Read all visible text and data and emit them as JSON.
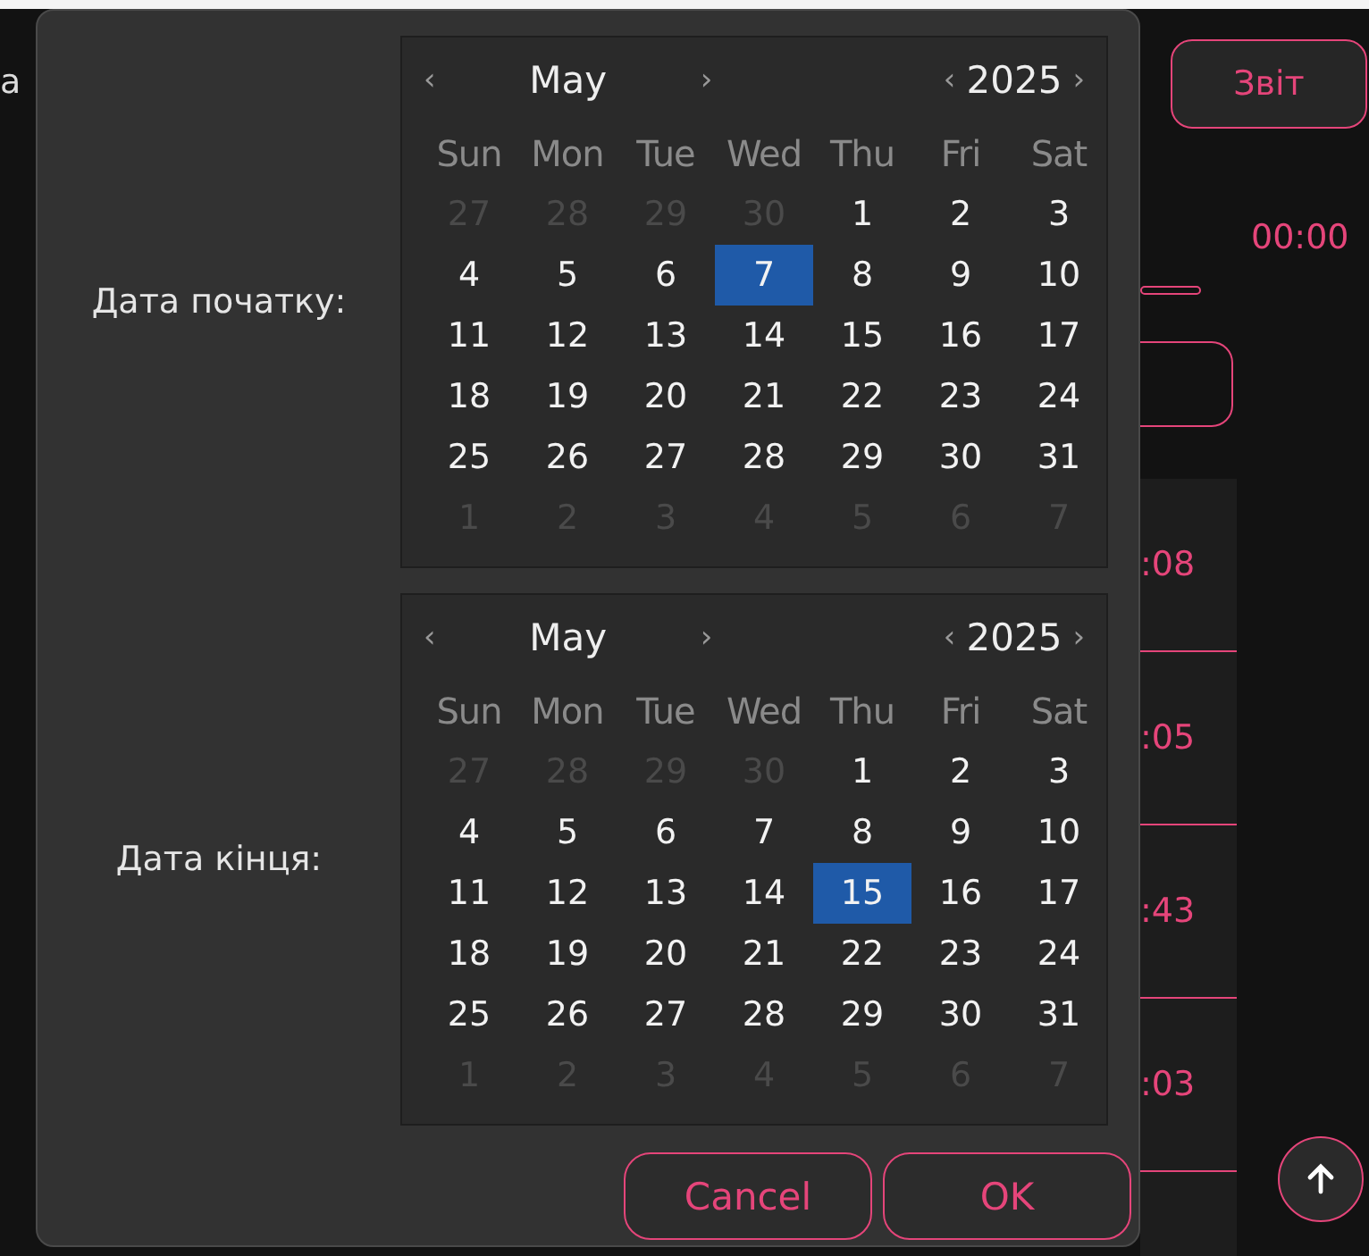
{
  "background": {
    "left_text": "а",
    "report_button": "Звіт",
    "time": "00:00",
    "list_times": [
      ":08",
      ":05",
      ":43",
      ":03"
    ]
  },
  "dialog": {
    "calendars": [
      {
        "label": "Дата початку:",
        "month": "May",
        "year": "2025",
        "prev": "‹",
        "next": "›",
        "weekdays": [
          "Sun",
          "Mon",
          "Tue",
          "Wed",
          "Thu",
          "Fri",
          "Sat"
        ],
        "weeks": [
          [
            {
              "text": "27",
              "kind": "other",
              "selected": false
            },
            {
              "text": "28",
              "kind": "other",
              "selected": false
            },
            {
              "text": "29",
              "kind": "other",
              "selected": false
            },
            {
              "text": "30",
              "kind": "other",
              "selected": false
            },
            {
              "text": "1",
              "kind": "current",
              "selected": false
            },
            {
              "text": "2",
              "kind": "current",
              "selected": false
            },
            {
              "text": "3",
              "kind": "current",
              "selected": false
            }
          ],
          [
            {
              "text": "4",
              "kind": "current",
              "selected": false
            },
            {
              "text": "5",
              "kind": "current",
              "selected": false
            },
            {
              "text": "6",
              "kind": "current",
              "selected": false
            },
            {
              "text": "7",
              "kind": "current",
              "selected": true
            },
            {
              "text": "8",
              "kind": "current",
              "selected": false
            },
            {
              "text": "9",
              "kind": "current",
              "selected": false
            },
            {
              "text": "10",
              "kind": "current",
              "selected": false
            }
          ],
          [
            {
              "text": "11",
              "kind": "current",
              "selected": false
            },
            {
              "text": "12",
              "kind": "current",
              "selected": false
            },
            {
              "text": "13",
              "kind": "current",
              "selected": false
            },
            {
              "text": "14",
              "kind": "current",
              "selected": false
            },
            {
              "text": "15",
              "kind": "current",
              "selected": false
            },
            {
              "text": "16",
              "kind": "current",
              "selected": false
            },
            {
              "text": "17",
              "kind": "current",
              "selected": false
            }
          ],
          [
            {
              "text": "18",
              "kind": "current",
              "selected": false
            },
            {
              "text": "19",
              "kind": "current",
              "selected": false
            },
            {
              "text": "20",
              "kind": "current",
              "selected": false
            },
            {
              "text": "21",
              "kind": "current",
              "selected": false
            },
            {
              "text": "22",
              "kind": "current",
              "selected": false
            },
            {
              "text": "23",
              "kind": "current",
              "selected": false
            },
            {
              "text": "24",
              "kind": "current",
              "selected": false
            }
          ],
          [
            {
              "text": "25",
              "kind": "current",
              "selected": false
            },
            {
              "text": "26",
              "kind": "current",
              "selected": false
            },
            {
              "text": "27",
              "kind": "current",
              "selected": false
            },
            {
              "text": "28",
              "kind": "current",
              "selected": false
            },
            {
              "text": "29",
              "kind": "current",
              "selected": false
            },
            {
              "text": "30",
              "kind": "current",
              "selected": false
            },
            {
              "text": "31",
              "kind": "current",
              "selected": false
            }
          ],
          [
            {
              "text": "1",
              "kind": "other",
              "selected": false
            },
            {
              "text": "2",
              "kind": "other",
              "selected": false
            },
            {
              "text": "3",
              "kind": "other",
              "selected": false
            },
            {
              "text": "4",
              "kind": "other",
              "selected": false
            },
            {
              "text": "5",
              "kind": "other",
              "selected": false
            },
            {
              "text": "6",
              "kind": "other",
              "selected": false
            },
            {
              "text": "7",
              "kind": "other",
              "selected": false
            }
          ]
        ]
      },
      {
        "label": "Дата кінця:",
        "month": "May",
        "year": "2025",
        "prev": "‹",
        "next": "›",
        "weekdays": [
          "Sun",
          "Mon",
          "Tue",
          "Wed",
          "Thu",
          "Fri",
          "Sat"
        ],
        "weeks": [
          [
            {
              "text": "27",
              "kind": "other",
              "selected": false
            },
            {
              "text": "28",
              "kind": "other",
              "selected": false
            },
            {
              "text": "29",
              "kind": "other",
              "selected": false
            },
            {
              "text": "30",
              "kind": "other",
              "selected": false
            },
            {
              "text": "1",
              "kind": "current",
              "selected": false
            },
            {
              "text": "2",
              "kind": "current",
              "selected": false
            },
            {
              "text": "3",
              "kind": "current",
              "selected": false
            }
          ],
          [
            {
              "text": "4",
              "kind": "current",
              "selected": false
            },
            {
              "text": "5",
              "kind": "current",
              "selected": false
            },
            {
              "text": "6",
              "kind": "current",
              "selected": false
            },
            {
              "text": "7",
              "kind": "current",
              "selected": false
            },
            {
              "text": "8",
              "kind": "current",
              "selected": false
            },
            {
              "text": "9",
              "kind": "current",
              "selected": false
            },
            {
              "text": "10",
              "kind": "current",
              "selected": false
            }
          ],
          [
            {
              "text": "11",
              "kind": "current",
              "selected": false
            },
            {
              "text": "12",
              "kind": "current",
              "selected": false
            },
            {
              "text": "13",
              "kind": "current",
              "selected": false
            },
            {
              "text": "14",
              "kind": "current",
              "selected": false
            },
            {
              "text": "15",
              "kind": "current",
              "selected": true
            },
            {
              "text": "16",
              "kind": "current",
              "selected": false
            },
            {
              "text": "17",
              "kind": "current",
              "selected": false
            }
          ],
          [
            {
              "text": "18",
              "kind": "current",
              "selected": false
            },
            {
              "text": "19",
              "kind": "current",
              "selected": false
            },
            {
              "text": "20",
              "kind": "current",
              "selected": false
            },
            {
              "text": "21",
              "kind": "current",
              "selected": false
            },
            {
              "text": "22",
              "kind": "current",
              "selected": false
            },
            {
              "text": "23",
              "kind": "current",
              "selected": false
            },
            {
              "text": "24",
              "kind": "current",
              "selected": false
            }
          ],
          [
            {
              "text": "25",
              "kind": "current",
              "selected": false
            },
            {
              "text": "26",
              "kind": "current",
              "selected": false
            },
            {
              "text": "27",
              "kind": "current",
              "selected": false
            },
            {
              "text": "28",
              "kind": "current",
              "selected": false
            },
            {
              "text": "29",
              "kind": "current",
              "selected": false
            },
            {
              "text": "30",
              "kind": "current",
              "selected": false
            },
            {
              "text": "31",
              "kind": "current",
              "selected": false
            }
          ],
          [
            {
              "text": "1",
              "kind": "other",
              "selected": false
            },
            {
              "text": "2",
              "kind": "other",
              "selected": false
            },
            {
              "text": "3",
              "kind": "other",
              "selected": false
            },
            {
              "text": "4",
              "kind": "other",
              "selected": false
            },
            {
              "text": "5",
              "kind": "other",
              "selected": false
            },
            {
              "text": "6",
              "kind": "other",
              "selected": false
            },
            {
              "text": "7",
              "kind": "other",
              "selected": false
            }
          ]
        ]
      }
    ],
    "buttons": [
      "Cancel",
      "OK"
    ]
  }
}
